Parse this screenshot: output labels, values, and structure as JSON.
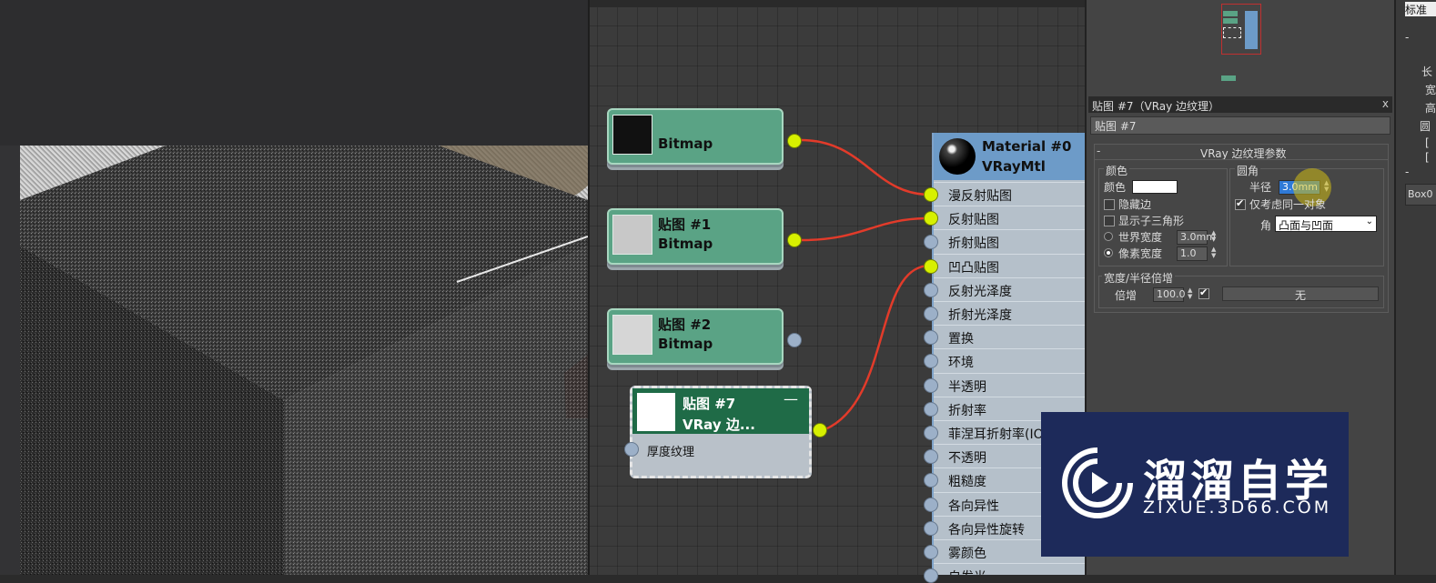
{
  "viewport": {
    "description_colors": {
      "background": "#2d2d2f"
    }
  },
  "node_editor": {
    "nodes": [
      {
        "title": "",
        "subtitle": "Bitmap"
      },
      {
        "title": "贴图 #1",
        "subtitle": "Bitmap"
      },
      {
        "title": "贴图 #2",
        "subtitle": "Bitmap"
      }
    ],
    "vray_node": {
      "title": "贴图 #7",
      "subtitle": "VRay 边...",
      "slot": "厚度纹理",
      "collapse": "—"
    },
    "material": {
      "title": "Material #0",
      "subtitle": "VRayMtl",
      "slots": [
        "漫反射贴图",
        "反射贴图",
        "折射贴图",
        "凹凸贴图",
        "反射光泽度",
        "折射光泽度",
        "置换",
        "环境",
        "半透明",
        "折射率",
        "菲涅耳折射率(IOR)",
        "不透明",
        "粗糙度",
        "各向异性",
        "各向异性旋转",
        "雾颜色",
        "自发光"
      ]
    },
    "colors": {
      "node_green": "#5aa385",
      "socket_active": "#d7f000",
      "wire": "#e23b2a",
      "material_header": "#6d9bc8"
    }
  },
  "params": {
    "panel_title": "贴图 #7（VRay 边纹理）",
    "close": "x",
    "map_name": "贴图 #7",
    "rollout_title": "VRay 边纹理参数",
    "color_group": "颜色",
    "color_label": "颜色",
    "hidden_edges": "隐藏边",
    "show_subtri": "显示子三角形",
    "world_width": "世界宽度",
    "world_width_value": "3.0mm",
    "pixel_width": "像素宽度",
    "pixel_width_value": "1.0",
    "round_group": "圆角",
    "radius_label": "半径",
    "radius_value": "3.0mm",
    "same_object": "仅考虑同一对象",
    "corner_label": "角",
    "corner_value": "凸面与凹面",
    "width_group": "宽度/半径倍增",
    "multiplier_label": "倍增",
    "multiplier_value": "100.0",
    "none_button": "无"
  },
  "far_right": {
    "dropdown": "标准",
    "labels": [
      "-",
      "长",
      "宽",
      "高",
      "圆",
      "[",
      "[",
      "-",
      "Box0"
    ]
  },
  "watermark": {
    "brand": "溜溜自学",
    "url": "ZIXUE.3D66.COM"
  }
}
